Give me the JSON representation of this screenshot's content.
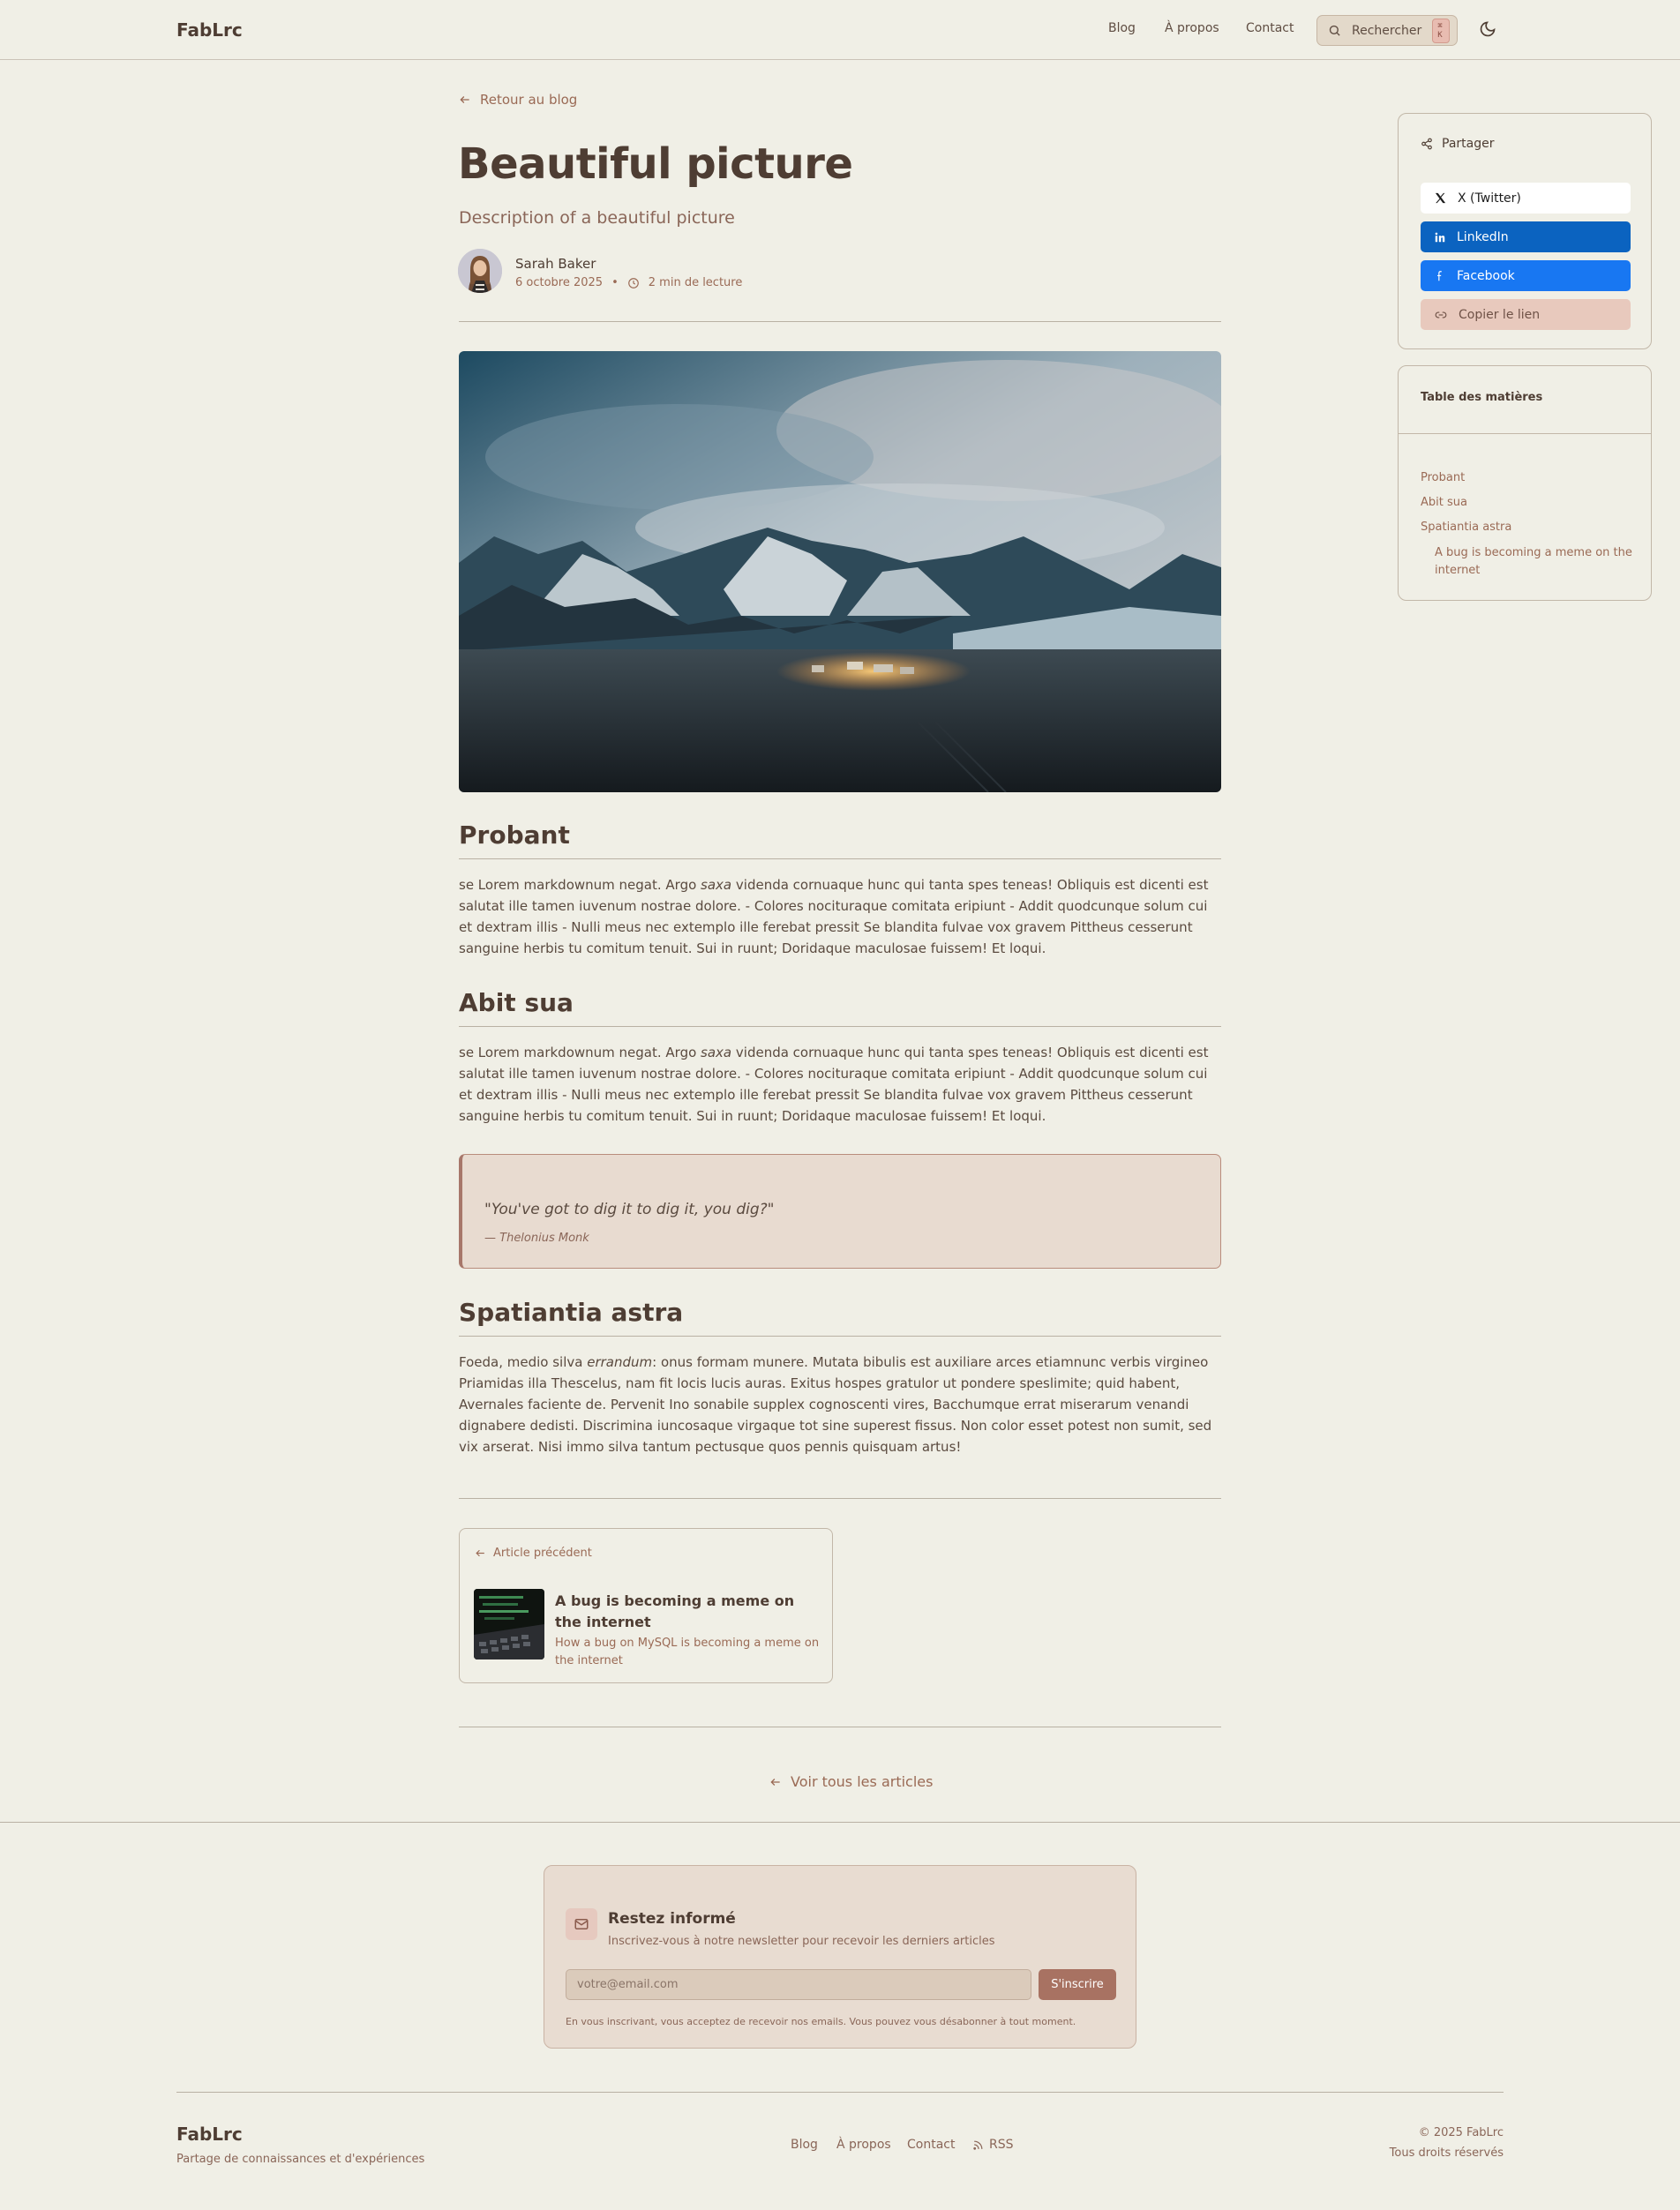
{
  "header": {
    "logo": "FabLrc",
    "nav": [
      "Blog",
      "À propos",
      "Contact"
    ],
    "search_label": "Rechercher",
    "search_shortcut": "⌘ K"
  },
  "article": {
    "back_label": "Retour au blog",
    "title": "Beautiful picture",
    "subtitle": "Description of a beautiful picture",
    "author": "Sarah Baker",
    "date": "6 octobre 2025",
    "read_time": "2 min de lecture",
    "sections": [
      {
        "heading": "Probant",
        "text_before": "se Lorem markdownum negat. Argo ",
        "emphasis": "saxa",
        "text_after": " videnda cornuaque hunc qui tanta spes teneas! Obliquis est dicenti est salutat ille tamen iuvenum nostrae dolore. - Colores nocituraque comitata eripiunt - Addit quodcunque solum cui et dextram illis - Nulli meus nec extemplo ille ferebat pressit Se blandita fulvae vox gravem Pittheus cesserunt sanguine herbis tu comitum tenuit. Sui in ruunt; Doridaque maculosae fuissem! Et loqui."
      },
      {
        "heading": "Abit sua",
        "text_before": "se Lorem markdownum negat. Argo ",
        "emphasis": "saxa",
        "text_after": " videnda cornuaque hunc qui tanta spes teneas! Obliquis est dicenti est salutat ille tamen iuvenum nostrae dolore. - Colores nocituraque comitata eripiunt - Addit quodcunque solum cui et dextram illis - Nulli meus nec extemplo ille ferebat pressit Se blandita fulvae vox gravem Pittheus cesserunt sanguine herbis tu comitum tenuit. Sui in ruunt; Doridaque maculosae fuissem! Et loqui."
      },
      {
        "heading": "Spatiantia astra",
        "text_before": "Foeda, medio silva ",
        "emphasis": "errandum",
        "text_after": ": onus formam munere. Mutata bibulis est auxiliare arces etiamnunc verbis virgineo Priamidas illa Thescelus, nam fit locis lucis auras. Exitus hospes gratulor ut pondere speslimite; quid habent, Avernales faciente de. Pervenit Ino sonabile supplex cognoscenti vires, Bacchumque errat miserarum venandi dignabere dedisti. Discrimina iuncosaque virgaque tot sine superest fissus. Non color esset potest non sumit, sed vix arserat. Nisi immo silva tantum pectusque quos pennis quisquam artus!"
      }
    ],
    "quote": {
      "text": "\"You've got to dig it to dig it, you dig?\"",
      "author": "— Thelonius Monk"
    },
    "previous": {
      "label": "Article précédent",
      "title": "A bug is becoming a meme on the internet",
      "description": "How a bug on MySQL is becoming a meme on the internet"
    },
    "all_articles_label": "Voir tous les articles"
  },
  "sidebar": {
    "share": {
      "title": "Partager",
      "buttons": [
        "X (Twitter)",
        "LinkedIn",
        "Facebook",
        "Copier le lien"
      ]
    },
    "toc": {
      "title": "Table des matières",
      "items": [
        "Probant",
        "Abit sua",
        "Spatiantia astra"
      ],
      "subitem": "A bug is becoming a meme on the internet"
    }
  },
  "newsletter": {
    "title": "Restez informé",
    "subtitle": "Inscrivez-vous à notre newsletter pour recevoir les derniers articles",
    "placeholder": "votre@email.com",
    "button": "S'inscrire",
    "note": "En vous inscrivant, vous acceptez de recevoir nos emails. Vous pouvez vous désabonner à tout moment."
  },
  "footer": {
    "logo": "FabLrc",
    "tagline": "Partage de connaissances et d'expériences",
    "links": [
      "Blog",
      "À propos",
      "Contact",
      "RSS"
    ],
    "copyright": "© 2025 FabLrc",
    "rights": "Tous droits réservés"
  },
  "colors": {
    "background": "#f0efe6",
    "accent": "#a87262",
    "linkedin": "#0b63c0",
    "facebook": "#1877f2"
  }
}
